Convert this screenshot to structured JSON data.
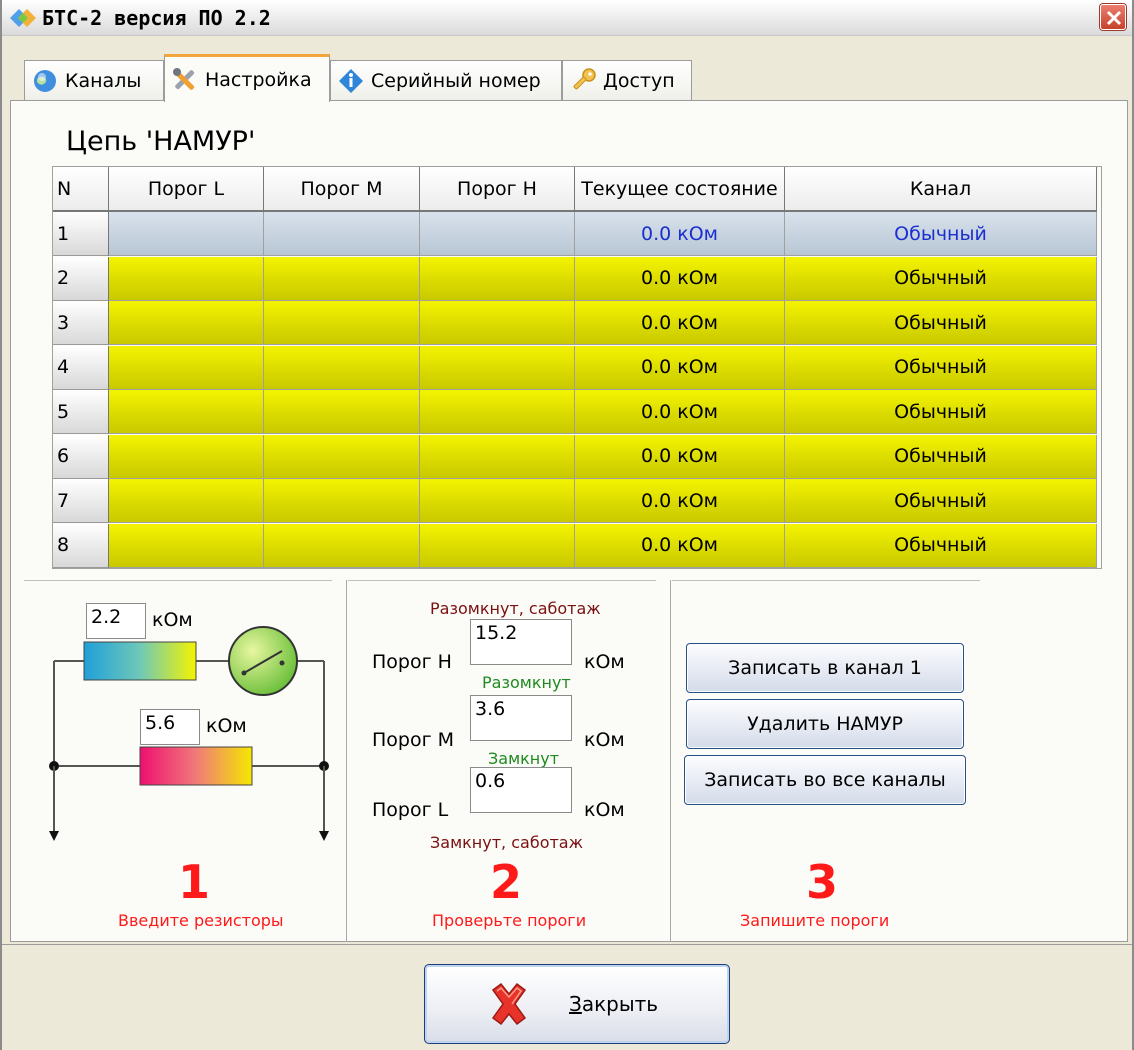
{
  "window": {
    "title": "БТС-2  версия ПО 2.2"
  },
  "tabs": [
    {
      "label": "Каналы",
      "icon": "globe-icon"
    },
    {
      "label": "Настройка",
      "icon": "tools-icon",
      "active": true
    },
    {
      "label": "Серийный номер",
      "icon": "info-icon"
    },
    {
      "label": "Доступ",
      "icon": "key-icon"
    }
  ],
  "circuit_title": "Цепь 'НАМУР'",
  "grid": {
    "headers": [
      "N",
      "Порог L",
      "Порог M",
      "Порог H",
      "Текущее состояние",
      "Канал"
    ],
    "rows": [
      {
        "n": "1",
        "porog_l": "",
        "porog_m": "",
        "porog_h": "",
        "state": "0.0 кОм",
        "channel": "Обычный",
        "selected": true
      },
      {
        "n": "2",
        "porog_l": "",
        "porog_m": "",
        "porog_h": "",
        "state": "0.0 кОм",
        "channel": "Обычный"
      },
      {
        "n": "3",
        "porog_l": "",
        "porog_m": "",
        "porog_h": "",
        "state": "0.0 кОм",
        "channel": "Обычный"
      },
      {
        "n": "4",
        "porog_l": "",
        "porog_m": "",
        "porog_h": "",
        "state": "0.0 кОм",
        "channel": "Обычный"
      },
      {
        "n": "5",
        "porog_l": "",
        "porog_m": "",
        "porog_h": "",
        "state": "0.0 кОм",
        "channel": "Обычный"
      },
      {
        "n": "6",
        "porog_l": "",
        "porog_m": "",
        "porog_h": "",
        "state": "0.0 кОм",
        "channel": "Обычный"
      },
      {
        "n": "7",
        "porog_l": "",
        "porog_m": "",
        "porog_h": "",
        "state": "0.0 кОм",
        "channel": "Обычный"
      },
      {
        "n": "8",
        "porog_l": "",
        "porog_m": "",
        "porog_h": "",
        "state": "0.0 кОм",
        "channel": "Обычный"
      }
    ]
  },
  "panel1": {
    "resistor1_value": "2.2",
    "resistor1_unit": "кОм",
    "resistor2_value": "5.6",
    "resistor2_unit": "кОм",
    "step_number": "1",
    "step_text": "Введите  резисторы"
  },
  "panel2": {
    "top_label": "Разомкнут, саботаж",
    "threshold_h_label": "Порог H",
    "threshold_h_value": "15.2",
    "threshold_h_unit": "кОм",
    "mid_label_1": "Разомкнут",
    "threshold_m_label": "Порог M",
    "threshold_m_value": "3.6",
    "threshold_m_unit": "кОм",
    "mid_label_2": "Замкнут",
    "threshold_l_label": "Порог L",
    "threshold_l_value": "0.6",
    "threshold_l_unit": "кОм",
    "bottom_label": "Замкнут, саботаж",
    "step_number": "2",
    "step_text": "Проверьте пороги"
  },
  "panel3": {
    "write_channel_button": "Записать в канал 1",
    "delete_namur_button": "Удалить НАМУР",
    "write_all_button": "Записать во все каналы",
    "step_number": "3",
    "step_text": "Запишите пороги"
  },
  "footer": {
    "close_prefix": "З",
    "close_rest": "акрыть"
  },
  "colors": {
    "row_yellow": "#e6e600",
    "row_selected": "#c4d0dc",
    "selected_text": "#1a2fd0",
    "step_red": "#ff1a1a",
    "threshold_red": "#7a1010",
    "threshold_green": "#1f8a1f"
  }
}
